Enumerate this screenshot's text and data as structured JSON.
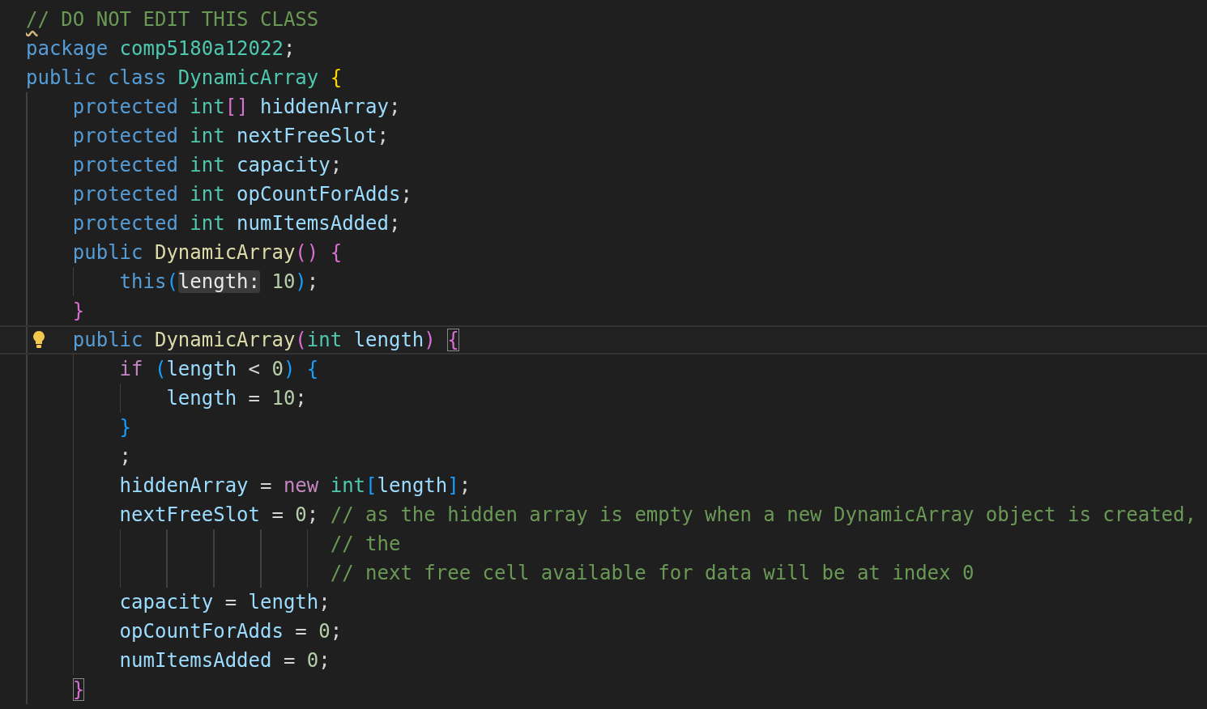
{
  "editor": {
    "lines": [
      {
        "current": false,
        "lightbulb": false,
        "tokens": [
          {
            "text": "/",
            "kind": "comment",
            "squiggle": true
          },
          {
            "text": "/ DO NOT EDIT THIS CLASS",
            "kind": "comment"
          }
        ]
      },
      {
        "current": false,
        "lightbulb": false,
        "tokens": [
          {
            "text": "package",
            "kind": "keyword"
          },
          {
            "text": " comp5180a12022",
            "kind": "type"
          },
          {
            "text": ";",
            "kind": "punct"
          }
        ]
      },
      {
        "current": false,
        "lightbulb": false,
        "tokens": [
          {
            "text": "public",
            "kind": "keyword"
          },
          {
            "text": " class",
            "kind": "keyword"
          },
          {
            "text": " DynamicArray",
            "kind": "type"
          },
          {
            "text": " {",
            "kind": "bracket1"
          }
        ]
      },
      {
        "current": false,
        "lightbulb": false,
        "tokens": [
          {
            "text": "    protected",
            "kind": "keyword"
          },
          {
            "text": " int",
            "kind": "type"
          },
          {
            "text": "[]",
            "kind": "bracket2"
          },
          {
            "text": " hiddenArray",
            "kind": "var"
          },
          {
            "text": ";",
            "kind": "punct"
          }
        ]
      },
      {
        "current": false,
        "lightbulb": false,
        "tokens": [
          {
            "text": "    protected",
            "kind": "keyword"
          },
          {
            "text": " int",
            "kind": "type"
          },
          {
            "text": " nextFreeSlot",
            "kind": "var"
          },
          {
            "text": ";",
            "kind": "punct"
          }
        ]
      },
      {
        "current": false,
        "lightbulb": false,
        "tokens": [
          {
            "text": "    protected",
            "kind": "keyword"
          },
          {
            "text": " int",
            "kind": "type"
          },
          {
            "text": " capacity",
            "kind": "var"
          },
          {
            "text": ";",
            "kind": "punct"
          }
        ]
      },
      {
        "current": false,
        "lightbulb": false,
        "tokens": [
          {
            "text": "    protected",
            "kind": "keyword"
          },
          {
            "text": " int",
            "kind": "type"
          },
          {
            "text": " opCountForAdds",
            "kind": "var"
          },
          {
            "text": ";",
            "kind": "punct"
          }
        ]
      },
      {
        "current": false,
        "lightbulb": false,
        "tokens": [
          {
            "text": "    protected",
            "kind": "keyword"
          },
          {
            "text": " int",
            "kind": "type"
          },
          {
            "text": " numItemsAdded",
            "kind": "var"
          },
          {
            "text": ";",
            "kind": "punct"
          }
        ]
      },
      {
        "current": false,
        "lightbulb": false,
        "tokens": [
          {
            "text": "    public",
            "kind": "keyword"
          },
          {
            "text": " DynamicArray",
            "kind": "func"
          },
          {
            "text": "()",
            "kind": "bracket2"
          },
          {
            "text": " {",
            "kind": "bracket2"
          }
        ]
      },
      {
        "current": false,
        "lightbulb": false,
        "tokens": [
          {
            "text": "        this",
            "kind": "keyword"
          },
          {
            "text": "(",
            "kind": "bracket3"
          },
          {
            "text": "length:",
            "kind": "hint"
          },
          {
            "text": " 10",
            "kind": "num"
          },
          {
            "text": ")",
            "kind": "bracket3"
          },
          {
            "text": ";",
            "kind": "punct"
          }
        ]
      },
      {
        "current": false,
        "lightbulb": false,
        "tokens": [
          {
            "text": "    }",
            "kind": "bracket2"
          }
        ]
      },
      {
        "current": true,
        "lightbulb": true,
        "tokens": [
          {
            "text": "    public",
            "kind": "keyword"
          },
          {
            "text": " DynamicArray",
            "kind": "func"
          },
          {
            "text": "(",
            "kind": "bracket2"
          },
          {
            "text": "int",
            "kind": "type"
          },
          {
            "text": " length",
            "kind": "var"
          },
          {
            "text": ")",
            "kind": "bracket2"
          },
          {
            "text": " {",
            "kind": "bracket2",
            "matched": true
          }
        ]
      },
      {
        "current": false,
        "lightbulb": false,
        "tokens": [
          {
            "text": "        if",
            "kind": "control"
          },
          {
            "text": " (",
            "kind": "bracket3"
          },
          {
            "text": "length",
            "kind": "var"
          },
          {
            "text": " <",
            "kind": "punct"
          },
          {
            "text": " 0",
            "kind": "num"
          },
          {
            "text": ")",
            "kind": "bracket3"
          },
          {
            "text": " {",
            "kind": "bracket3"
          }
        ]
      },
      {
        "current": false,
        "lightbulb": false,
        "tokens": [
          {
            "text": "            length",
            "kind": "var"
          },
          {
            "text": " =",
            "kind": "punct"
          },
          {
            "text": " 10",
            "kind": "num"
          },
          {
            "text": ";",
            "kind": "punct"
          }
        ]
      },
      {
        "current": false,
        "lightbulb": false,
        "tokens": [
          {
            "text": "        }",
            "kind": "bracket3"
          }
        ]
      },
      {
        "current": false,
        "lightbulb": false,
        "tokens": [
          {
            "text": "        ;",
            "kind": "punct"
          }
        ]
      },
      {
        "current": false,
        "lightbulb": false,
        "tokens": [
          {
            "text": "        hiddenArray",
            "kind": "var"
          },
          {
            "text": " =",
            "kind": "punct"
          },
          {
            "text": " new",
            "kind": "control"
          },
          {
            "text": " int",
            "kind": "type"
          },
          {
            "text": "[",
            "kind": "bracket3"
          },
          {
            "text": "length",
            "kind": "var"
          },
          {
            "text": "]",
            "kind": "bracket3"
          },
          {
            "text": ";",
            "kind": "punct"
          }
        ]
      },
      {
        "current": false,
        "lightbulb": false,
        "tokens": [
          {
            "text": "        nextFreeSlot",
            "kind": "var"
          },
          {
            "text": " =",
            "kind": "punct"
          },
          {
            "text": " 0",
            "kind": "num"
          },
          {
            "text": ";",
            "kind": "punct"
          },
          {
            "text": " // as the hidden array is empty when a new DynamicArray object is created,",
            "kind": "comment"
          }
        ]
      },
      {
        "current": false,
        "lightbulb": false,
        "tokens": [
          {
            "text": "                          // the",
            "kind": "comment"
          }
        ]
      },
      {
        "current": false,
        "lightbulb": false,
        "tokens": [
          {
            "text": "                          // next free cell available for data will be at index 0",
            "kind": "comment"
          }
        ]
      },
      {
        "current": false,
        "lightbulb": false,
        "tokens": [
          {
            "text": "        capacity",
            "kind": "var"
          },
          {
            "text": " =",
            "kind": "punct"
          },
          {
            "text": " length",
            "kind": "var"
          },
          {
            "text": ";",
            "kind": "punct"
          }
        ]
      },
      {
        "current": false,
        "lightbulb": false,
        "tokens": [
          {
            "text": "        opCountForAdds",
            "kind": "var"
          },
          {
            "text": " =",
            "kind": "punct"
          },
          {
            "text": " 0",
            "kind": "num"
          },
          {
            "text": ";",
            "kind": "punct"
          }
        ]
      },
      {
        "current": false,
        "lightbulb": false,
        "tokens": [
          {
            "text": "        numItemsAdded",
            "kind": "var"
          },
          {
            "text": " =",
            "kind": "punct"
          },
          {
            "text": " 0",
            "kind": "num"
          },
          {
            "text": ";",
            "kind": "punct"
          }
        ]
      },
      {
        "current": false,
        "lightbulb": false,
        "tokens": [
          {
            "text": "    }",
            "kind": "bracket2",
            "matched": true
          }
        ]
      }
    ]
  }
}
